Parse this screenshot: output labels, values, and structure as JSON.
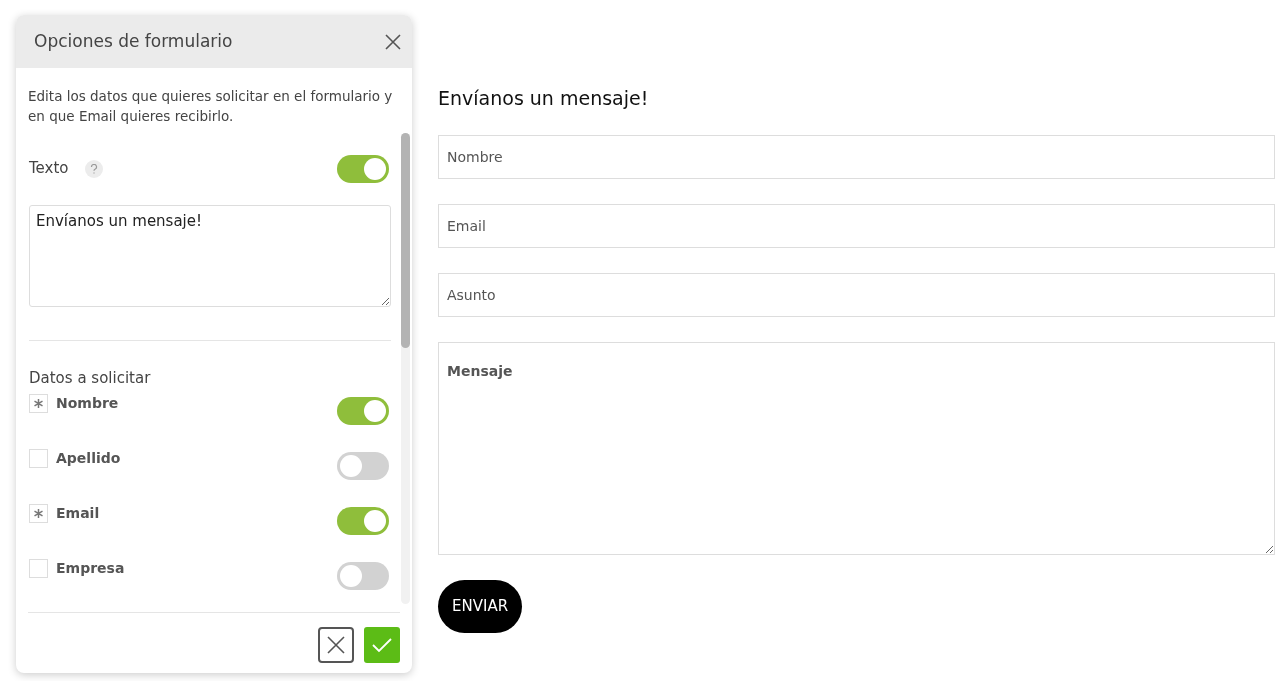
{
  "panel": {
    "title": "Opciones de formulario",
    "description": "Edita los datos que quieres solicitar en el formulario y en que Email quieres recibirlo.",
    "text_option": {
      "label": "Texto",
      "enabled": true,
      "value": "Envíanos un mensaje!"
    },
    "section_label": "Datos a solicitar",
    "fields": [
      {
        "label": "Nombre",
        "required": true,
        "enabled": true
      },
      {
        "label": "Apellido",
        "required": false,
        "enabled": false
      },
      {
        "label": "Email",
        "required": true,
        "enabled": true
      },
      {
        "label": "Empresa",
        "required": false,
        "enabled": false
      }
    ]
  },
  "preview": {
    "heading": "Envíanos un mensaje!",
    "fields": [
      {
        "kind": "input",
        "placeholder": "Nombre"
      },
      {
        "kind": "input",
        "placeholder": "Email"
      },
      {
        "kind": "input",
        "placeholder": "Asunto"
      },
      {
        "kind": "textarea",
        "placeholder": "Mensaje"
      }
    ],
    "submit": "ENVIAR"
  }
}
